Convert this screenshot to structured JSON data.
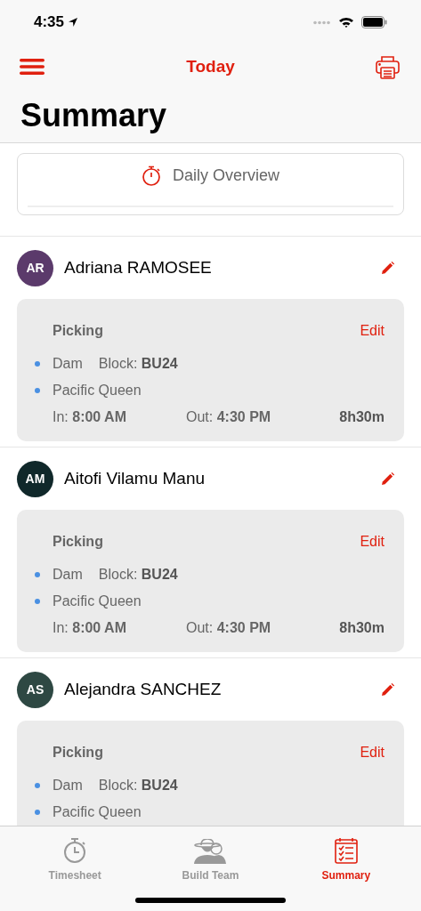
{
  "status_bar": {
    "time": "4:35"
  },
  "nav": {
    "title": "Today",
    "large_title": "Summary"
  },
  "overview": {
    "title": "Daily Overview"
  },
  "workers": [
    {
      "initials": "AR",
      "name": "Adriana RAMOSEE",
      "color": "#5b3a6b",
      "task": "Picking",
      "edit": "Edit",
      "locations": [
        {
          "name": "Dam",
          "block": "Block: **BU24**"
        },
        {
          "name": "Pacific Queen"
        }
      ],
      "in": "In: **8:00 AM**",
      "out": "Out: **4:30 PM**",
      "duration": "8h30m"
    },
    {
      "initials": "AM",
      "name": "Aitofi Vilamu Manu",
      "color": "#10282a",
      "task": "Picking",
      "edit": "Edit",
      "locations": [
        {
          "name": "Dam",
          "block": "Block: **BU24**"
        },
        {
          "name": "Pacific Queen"
        }
      ],
      "in": "In: **8:00 AM**",
      "out": "Out: **4:30 PM**",
      "duration": "8h30m"
    },
    {
      "initials": "AS",
      "name": "Alejandra SANCHEZ",
      "color": "#2e4843",
      "task": "Picking",
      "edit": "Edit",
      "locations": [
        {
          "name": "Dam",
          "block": "Block: **BU24**"
        },
        {
          "name": "Pacific Queen"
        }
      ]
    }
  ],
  "tabs": [
    {
      "label": "Timesheet",
      "kind": "timer",
      "selected": false
    },
    {
      "label": "Build Team",
      "kind": "team",
      "selected": false
    },
    {
      "label": "Summary",
      "kind": "checklist",
      "selected": true
    }
  ]
}
